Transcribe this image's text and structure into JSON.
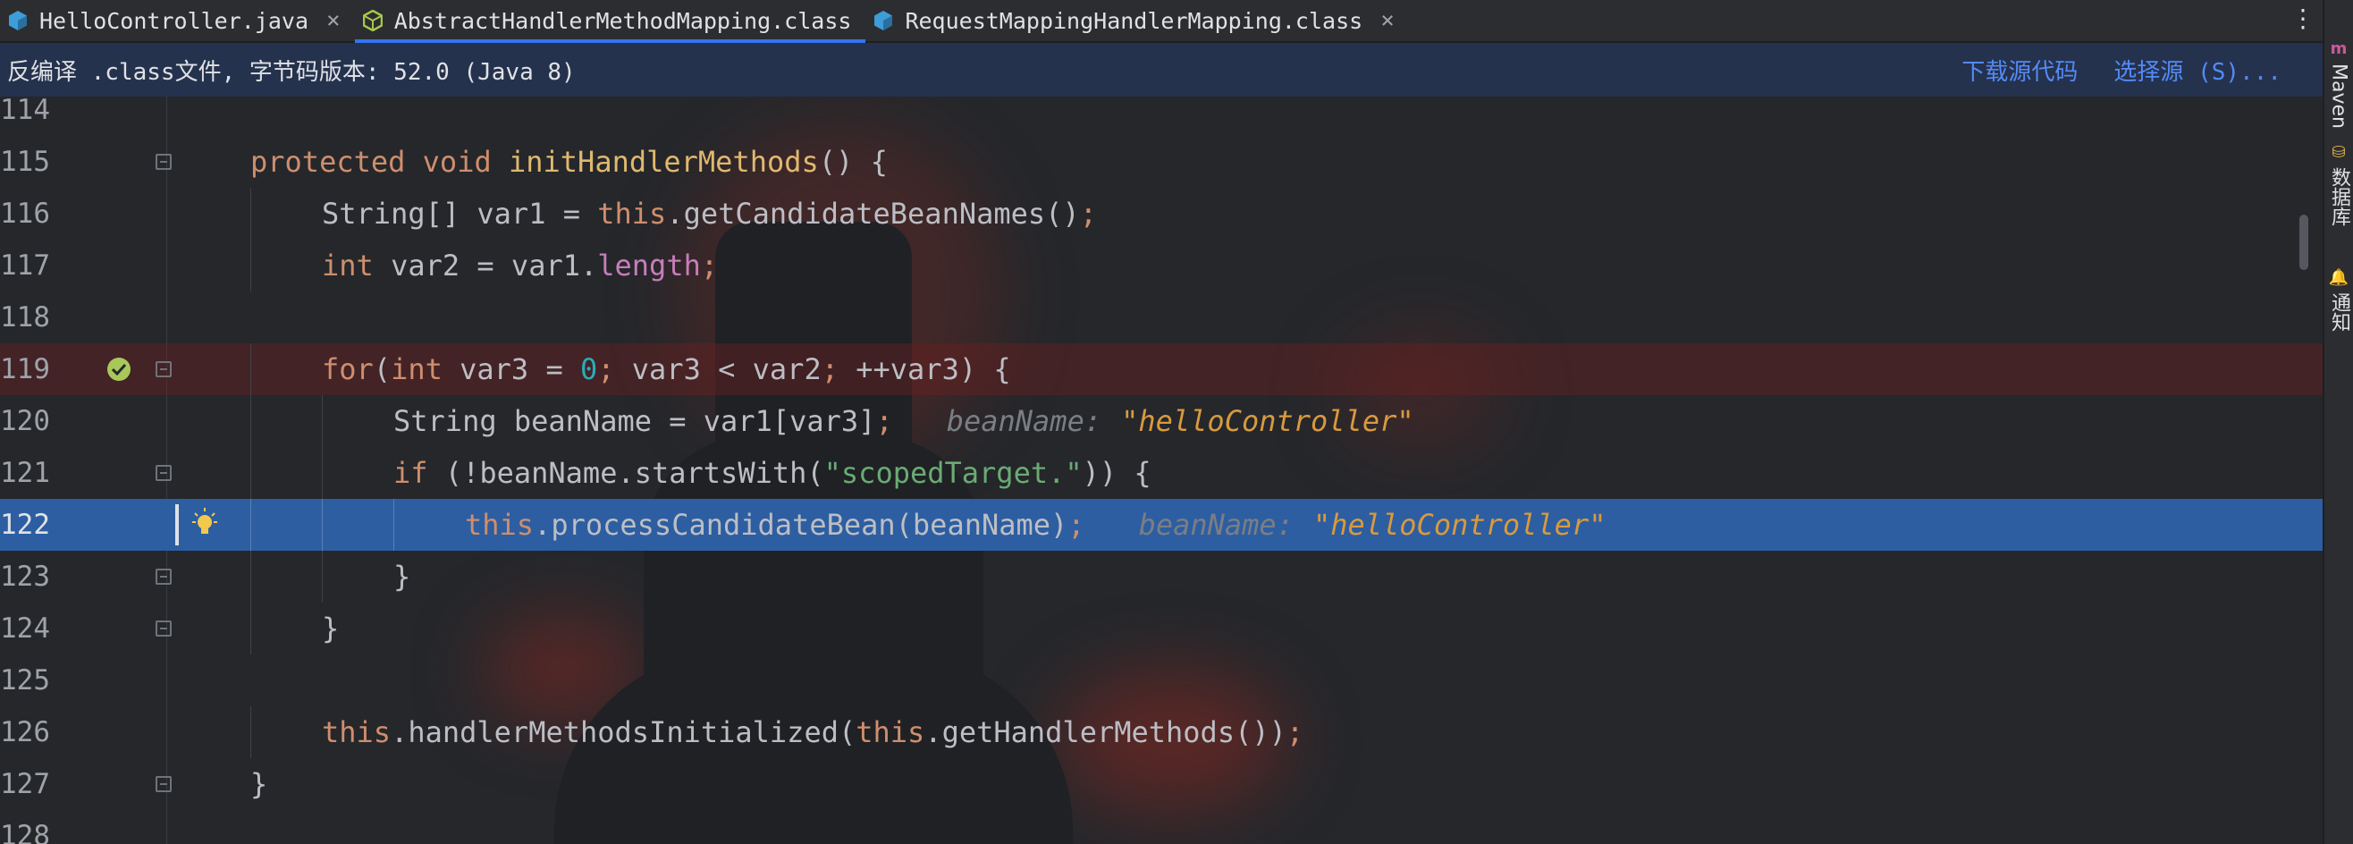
{
  "tabs": [
    {
      "label": "HelloController.java",
      "icon": "java-class-icon",
      "icon_color": "#3d9dd8",
      "active": false
    },
    {
      "label": "AbstractHandlerMethodMapping.class",
      "icon": "abstract-class-icon",
      "icon_color": "#a7c64b",
      "active": true
    },
    {
      "label": "RequestMappingHandlerMapping.class",
      "icon": "class-icon",
      "icon_color": "#3d9dd8",
      "active": false
    }
  ],
  "more_label": "⋮",
  "close_glyph": "×",
  "banner": {
    "message": "反编译 .class文件, 字节码版本: 52.0 (Java 8)",
    "download_link": "下载源代码",
    "choose_source_link": "选择源 (S)..."
  },
  "right_tools": {
    "maven": "Maven",
    "database": "数据库",
    "notifications": "通知"
  },
  "editor": {
    "lines": [
      {
        "n": "114"
      },
      {
        "n": "115",
        "code": [
          [
            "kw",
            "protected "
          ],
          [
            "kw",
            "void "
          ],
          [
            "fnd",
            "initHandlerMethods"
          ],
          [
            "",
            "() {"
          ]
        ],
        "fold": true
      },
      {
        "n": "116",
        "indent": 1,
        "code": [
          [
            "",
            "String[] var1 = "
          ],
          [
            "kw",
            "this"
          ],
          [
            "",
            ".getCandidateBeanNames()"
          ],
          [
            "kw",
            ";"
          ]
        ]
      },
      {
        "n": "117",
        "indent": 1,
        "code": [
          [
            "kw",
            "int "
          ],
          [
            "",
            "var2 = var1."
          ],
          [
            "fld",
            "length"
          ],
          [
            "kw",
            ";"
          ]
        ]
      },
      {
        "n": "118"
      },
      {
        "n": "119",
        "indent": 1,
        "code": [
          [
            "kw",
            "for"
          ],
          [
            "",
            "("
          ],
          [
            "kw",
            "int "
          ],
          [
            "",
            "var3 = "
          ],
          [
            "num",
            "0"
          ],
          [
            "kw",
            "; "
          ],
          [
            "",
            "var3 < var2"
          ],
          [
            "kw",
            "; "
          ],
          [
            "",
            "++var3) {"
          ]
        ],
        "fold": true,
        "breakpoint": true
      },
      {
        "n": "120",
        "indent": 2,
        "code": [
          [
            "",
            "String beanName = var1[var3]"
          ],
          [
            "kw",
            ";"
          ]
        ],
        "hint_name": "beanName:",
        "hint_value": "\"helloController\""
      },
      {
        "n": "121",
        "indent": 2,
        "code": [
          [
            "kw",
            "if "
          ],
          [
            "",
            "(!beanName.startsWith("
          ],
          [
            "str",
            "\"scopedTarget.\""
          ],
          [
            "",
            ")) {"
          ]
        ],
        "fold": true
      },
      {
        "n": "122",
        "indent": 3,
        "code": [
          [
            "kw",
            "this"
          ],
          [
            "",
            ".processCandidateBean(beanName)"
          ],
          [
            "kw",
            ";"
          ]
        ],
        "hint_name": "beanName:",
        "hint_value": "\"helloController\"",
        "current": true
      },
      {
        "n": "123",
        "indent": 2,
        "code": [
          [
            "",
            "}"
          ]
        ],
        "fold_end": true
      },
      {
        "n": "124",
        "indent": 1,
        "code": [
          [
            "",
            "}"
          ]
        ],
        "fold_end": true
      },
      {
        "n": "125"
      },
      {
        "n": "126",
        "indent": 1,
        "code": [
          [
            "kw",
            "this"
          ],
          [
            "",
            ".handlerMethodsInitialized("
          ],
          [
            "kw",
            "this"
          ],
          [
            "",
            ".getHandlerMethods())"
          ],
          [
            "kw",
            ";"
          ]
        ]
      },
      {
        "n": "127",
        "code": [
          [
            "",
            "}"
          ]
        ],
        "fold_end": true
      },
      {
        "n": "128"
      }
    ]
  }
}
